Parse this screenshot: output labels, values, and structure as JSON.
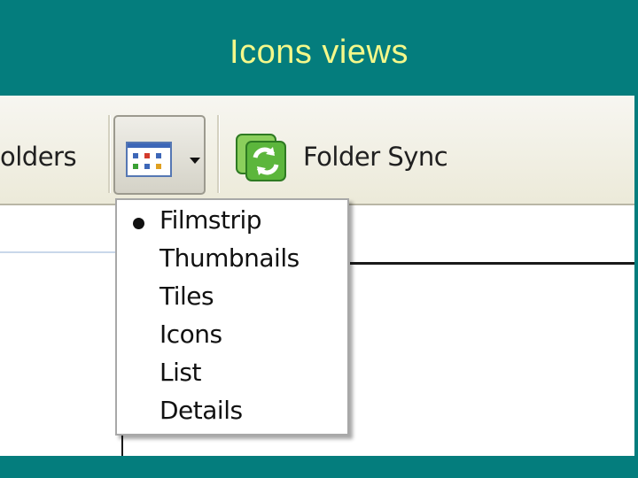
{
  "slide": {
    "title": "Icons views"
  },
  "toolbar": {
    "folders_label": "Folders",
    "folders_visible_text": "olders",
    "views_icon": "views-grid-icon",
    "views_dropdown_icon": "chevron-down-icon",
    "sync_icon": "folder-sync-icon",
    "sync_label": "Folder Sync"
  },
  "views_menu": {
    "items": [
      {
        "label": "Filmstrip",
        "selected": true
      },
      {
        "label": "Thumbnails",
        "selected": false
      },
      {
        "label": "Tiles",
        "selected": false
      },
      {
        "label": "Icons",
        "selected": false
      },
      {
        "label": "List",
        "selected": false
      },
      {
        "label": "Details",
        "selected": false
      }
    ]
  },
  "colors": {
    "slide_background": "#047d7d",
    "title_text": "#f4f88a",
    "sync_green": "#3aa035",
    "icon_blue": "#3d67b8"
  }
}
